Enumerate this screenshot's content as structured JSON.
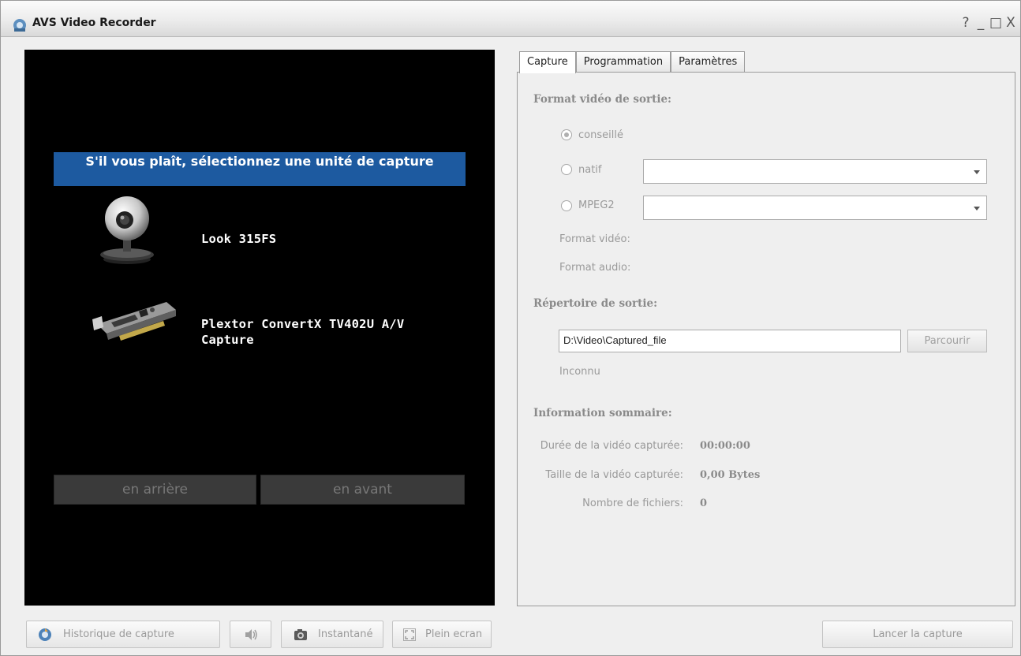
{
  "window": {
    "title": "AVS Video Recorder",
    "controls": [
      "?",
      "_",
      "□",
      "X"
    ]
  },
  "preview": {
    "prompt": "S'il vous plaît, sélectionnez une unité de capture",
    "devices": [
      {
        "label": "Look 315FS",
        "icon": "webcam-icon"
      },
      {
        "label": "Plextor ConvertX TV402U A/V Capture",
        "icon": "capture-card-icon"
      }
    ],
    "back_label": "en arrière",
    "forward_label": "en avant"
  },
  "tabs": [
    {
      "label": "Capture",
      "active": true
    },
    {
      "label": "Programmation",
      "active": false
    },
    {
      "label": "Paramètres",
      "active": false
    }
  ],
  "capture": {
    "format_title": "Format vidéo de sortie:",
    "radio_recommended": "conseillé",
    "radio_native": "natif",
    "radio_mpeg2": "MPEG2",
    "native_value": "",
    "mpeg2_value": "",
    "video_format_label": "Format vidéo:",
    "audio_format_label": "Format audio:",
    "output_dir_title": "Répertoire de sortie:",
    "output_path": "D:\\Video\\Captured_file",
    "browse_label": "Parcourir",
    "unknown_label": "Inconnu",
    "summary_title": "Information sommaire:",
    "duration_label": "Durée de la vidéo capturée:",
    "duration_value": "00:00:00",
    "size_label": "Taille de la vidéo capturée:",
    "size_value": "0,00 Bytes",
    "files_label": "Nombre de fichiers:",
    "files_value": "0"
  },
  "toolbar": {
    "history_label": "Historique de capture",
    "snapshot_label": "Instantané",
    "fullscreen_label": "Plein ecran",
    "start_label": "Lancer la capture"
  },
  "colors": {
    "banner": "#1d5aa0",
    "preview_bg": "#000000",
    "disabled_text": "#9a9a9a"
  }
}
